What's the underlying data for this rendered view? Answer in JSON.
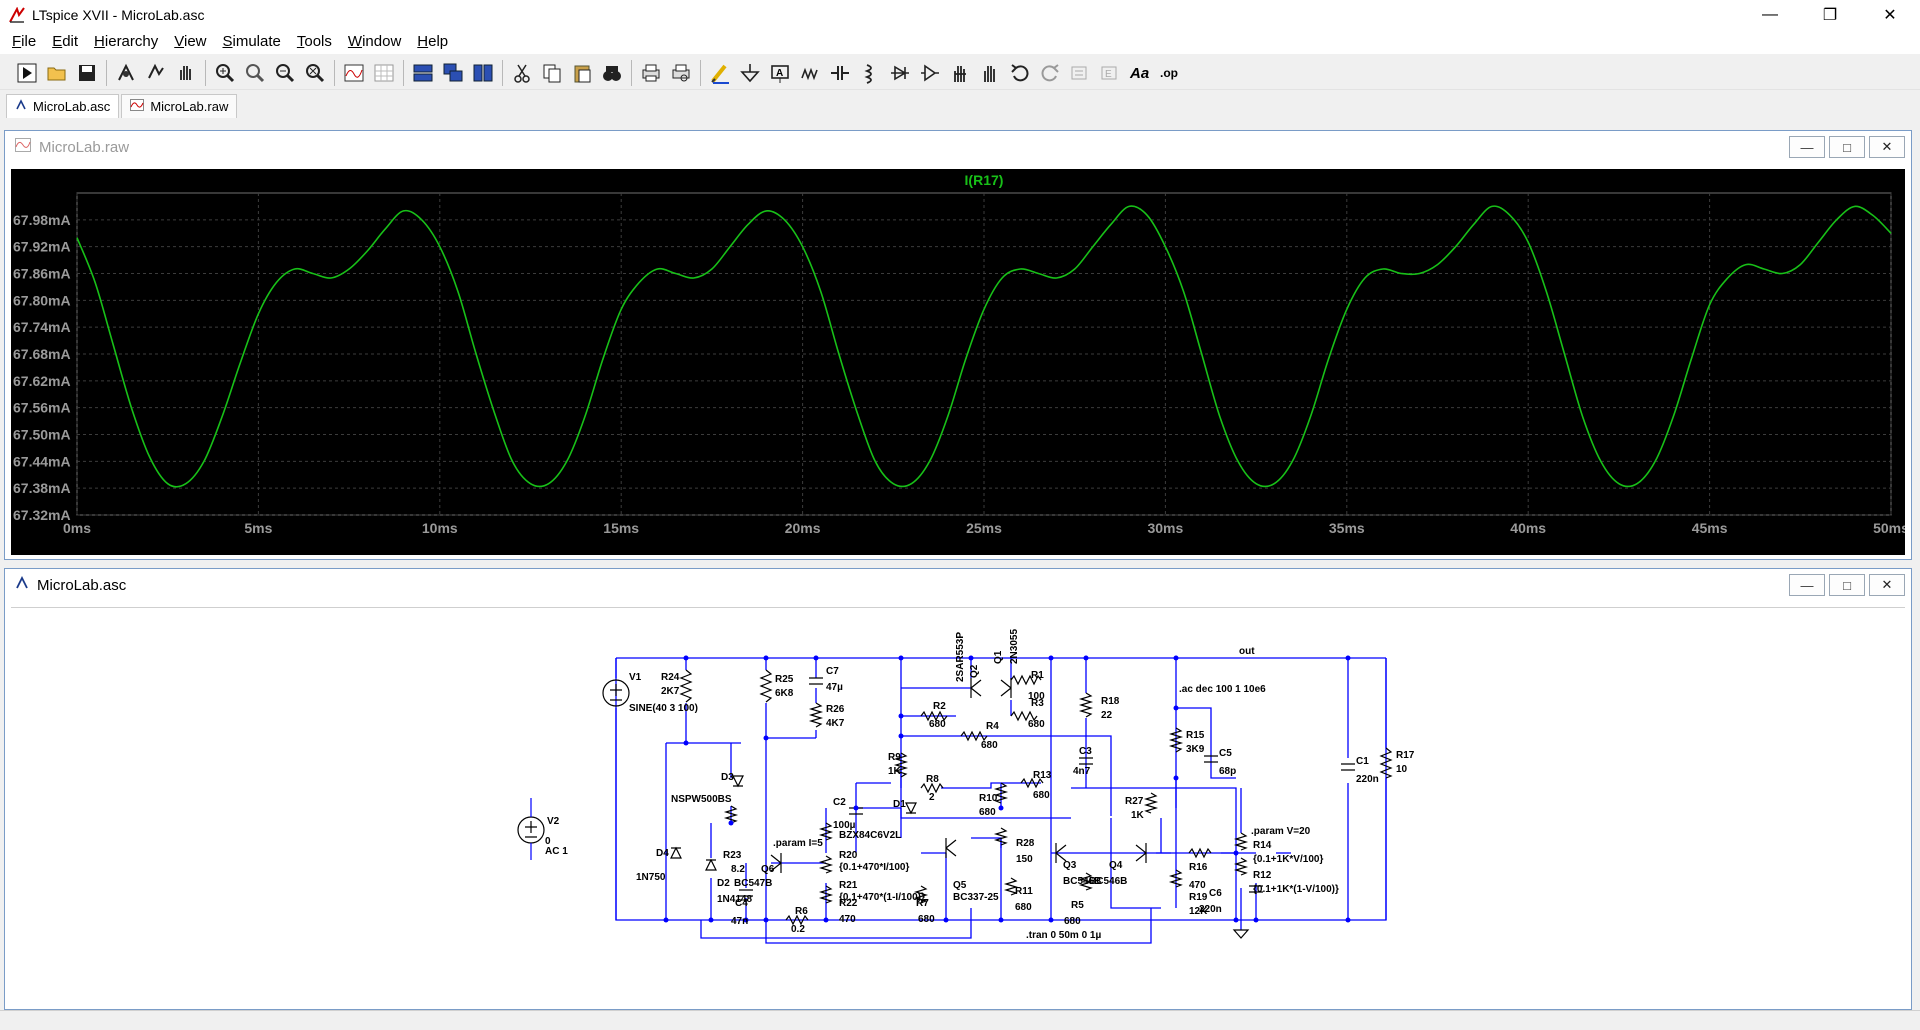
{
  "window": {
    "title": "LTspice XVII - MicroLab.asc",
    "controls": [
      "minimize-icon",
      "restore-icon",
      "close-icon"
    ]
  },
  "menu": [
    {
      "label": "File",
      "u": "F",
      "rest": "ile"
    },
    {
      "label": "Edit",
      "u": "E",
      "rest": "dit"
    },
    {
      "label": "Hierarchy",
      "u": "H",
      "rest": "ierarchy"
    },
    {
      "label": "View",
      "u": "V",
      "rest": "iew"
    },
    {
      "label": "Simulate",
      "u": "S",
      "rest": "imulate"
    },
    {
      "label": "Tools",
      "u": "T",
      "rest": "ools"
    },
    {
      "label": "Window",
      "u": "W",
      "rest": "indow"
    },
    {
      "label": "Help",
      "u": "H",
      "rest": "elp"
    }
  ],
  "toolbar": [
    "run-icon",
    "open-icon",
    "save-icon",
    "|",
    "control-panel-icon",
    "halt-icon",
    "pan-icon",
    "|",
    "zoom-in-icon",
    "zoom-full-icon",
    "zoom-out-icon",
    "zoom-cancel-icon",
    "|",
    "autorange-icon",
    "grid-icon",
    "|",
    "tile-horizontal-icon",
    "cascade-icon",
    "tile-vertical-icon",
    "|",
    "cut-icon",
    "copy-icon",
    "paste-icon",
    "find-icon",
    "|",
    "print-icon",
    "print-preview-icon",
    "|",
    "wire-icon",
    "ground-icon",
    "label-net-icon",
    "resistor-icon",
    "capacitor-icon",
    "inductor-icon",
    "diode-icon",
    "component-icon",
    "move-icon",
    "drag-icon",
    "undo-icon",
    "redo-icon",
    "rotate-icon",
    "mirror-icon",
    "text-icon",
    "spice-directive-icon"
  ],
  "tabs": [
    {
      "label": "MicroLab.asc",
      "icon": "schematic-icon",
      "active": true
    },
    {
      "label": "MicroLab.raw",
      "icon": "waveform-icon",
      "active": false
    }
  ],
  "wave_window": {
    "title": "MicroLab.raw",
    "trace_label": "I(R17)",
    "trace_color": "#18c018",
    "grid_color": "#3c3c3c",
    "label_color": "#9a9a9a"
  },
  "chart_data": {
    "type": "line",
    "title": "I(R17)",
    "xlabel": "",
    "ylabel": "",
    "xlim": [
      0,
      50
    ],
    "ylim": [
      67.32,
      68.04
    ],
    "x_ticks": [
      "0ms",
      "5ms",
      "10ms",
      "15ms",
      "20ms",
      "25ms",
      "30ms",
      "35ms",
      "40ms",
      "45ms",
      "50ms"
    ],
    "y_ticks": [
      "67.98mA",
      "67.92mA",
      "67.86mA",
      "67.80mA",
      "67.74mA",
      "67.68mA",
      "67.62mA",
      "67.56mA",
      "67.50mA",
      "67.44mA",
      "67.38mA",
      "67.32mA"
    ],
    "y_tick_values": [
      67.98,
      67.92,
      67.86,
      67.8,
      67.74,
      67.68,
      67.62,
      67.56,
      67.5,
      67.44,
      67.38,
      67.32
    ],
    "grid": true,
    "series": [
      {
        "name": "I(R17)",
        "x": [
          0,
          0.5,
          1,
          1.5,
          2,
          2.5,
          3,
          3.5,
          4,
          4.5,
          5,
          5.5,
          6,
          6.5,
          7,
          7.5,
          8,
          8.5,
          9,
          9.5,
          10,
          10.5,
          11,
          11.5,
          12,
          12.5,
          13,
          13.5,
          14,
          14.5,
          15,
          15.5,
          16,
          16.5,
          17,
          17.5,
          18,
          18.5,
          19,
          19.5,
          20,
          20.5,
          21,
          21.5,
          22,
          22.5,
          23,
          23.5,
          24,
          24.5,
          25,
          25.5,
          26,
          26.5,
          27,
          27.5,
          28,
          28.5,
          29,
          29.5,
          30,
          30.5,
          31,
          31.5,
          32,
          32.5,
          33,
          33.5,
          34,
          34.5,
          35,
          35.5,
          36,
          36.5,
          37,
          37.5,
          38,
          38.5,
          39,
          39.5,
          40,
          40.5,
          41,
          41.5,
          42,
          42.5,
          43,
          43.5,
          44,
          44.5,
          45,
          45.5,
          46,
          46.5,
          47,
          47.5,
          48,
          48.5,
          49,
          49.5,
          50
        ],
        "values": [
          67.94,
          67.84,
          67.7,
          67.56,
          67.45,
          67.39,
          67.39,
          67.44,
          67.54,
          67.66,
          67.77,
          67.84,
          67.87,
          67.86,
          67.85,
          67.87,
          67.91,
          67.96,
          68.0,
          67.98,
          67.92,
          67.82,
          67.68,
          67.55,
          67.44,
          67.39,
          67.39,
          67.44,
          67.54,
          67.67,
          67.78,
          67.84,
          67.87,
          67.86,
          67.85,
          67.87,
          67.92,
          67.97,
          68.0,
          67.98,
          67.92,
          67.82,
          67.68,
          67.55,
          67.44,
          67.39,
          67.39,
          67.44,
          67.54,
          67.67,
          67.78,
          67.85,
          67.87,
          67.86,
          67.85,
          67.87,
          67.92,
          67.97,
          68.01,
          67.99,
          67.92,
          67.82,
          67.68,
          67.54,
          67.44,
          67.39,
          67.39,
          67.44,
          67.54,
          67.67,
          67.78,
          67.85,
          67.87,
          67.86,
          67.86,
          67.88,
          67.92,
          67.97,
          68.01,
          67.99,
          67.93,
          67.82,
          67.68,
          67.54,
          67.44,
          67.39,
          67.39,
          67.44,
          67.54,
          67.67,
          67.79,
          67.85,
          67.88,
          67.87,
          67.86,
          67.88,
          67.93,
          67.98,
          68.01,
          67.99,
          67.95
        ]
      }
    ]
  },
  "schem_window": {
    "title": "MicroLab.asc",
    "wire_color": "#0000ff",
    "component_color": "#000000",
    "labels": {
      "out": "out",
      "v1": "V1",
      "v1_val": "SINE(40 3 100)",
      "v2": "V2",
      "v2_v": "0",
      "v2_ac": "AC 1",
      "r24": "R24",
      "r24_v": "2K7",
      "r25": "R25",
      "r25_v": "6K8",
      "c7": "C7",
      "c7_v": "47µ",
      "r26": "R26",
      "r26_v": "4K7",
      "q2": "Q2",
      "q2_t": "2SAR553P",
      "q1": "Q1",
      "q1_t": "2N3055",
      "r1": "R1",
      "r1_v": "100",
      "r2": "R2",
      "r2_v": "680",
      "r3": "R3",
      "r3_v": "680",
      "r4": "R4",
      "r4_v": "680",
      "r18": "R18",
      "r18_v": "22",
      "ac_dir": ".ac dec 100 1 10e6",
      "r15": "R15",
      "r15_v": "3K9",
      "c5": "C5",
      "c5_v": "68p",
      "c1": "C1",
      "c1_v": "220n",
      "r17": "R17",
      "r17_v": "10",
      "r9": "R9",
      "r9_v": "1K",
      "c3": "C3",
      "c3_v": "4n7",
      "d3": "D3",
      "d3_t": "NSPW500BS",
      "r8": "R8",
      "r8_v": "2",
      "r13": "R13",
      "r13_v": "680",
      "c2": "C2",
      "c2_v": "100µ",
      "d1": "D1",
      "d1_t": "BZX84C6V2L",
      "r10": "R10",
      "r10_v": "680",
      "r27": "R27",
      "r27_v": "1K",
      "param_v": ".param V=20",
      "param_i": ".param I=5",
      "r14": "R14",
      "r14_v": "{0.1+1K*V/100}",
      "r12": "R12",
      "r12_v": "{0.1+1K*(1-V/100)}",
      "d4": "D4",
      "d4_t": "1N750",
      "r23": "R23",
      "r23_v": "8.2",
      "q6": "Q6",
      "q6_t": "BC547B",
      "r20": "R20",
      "r20_v": "{0.1+470*I/100}",
      "r28": "R28",
      "r28_v": "150",
      "q3": "Q3",
      "q3_t": "BC546B",
      "q4": "Q4",
      "q4_t": "BC546B",
      "r16": "R16",
      "r16_v": "470",
      "d2": "D2",
      "d2_t": "1N4148",
      "r21": "R21",
      "r21_v": "{0.1+470*(1-I/100)}",
      "q5": "Q5",
      "q5_t": "BC337-25",
      "r19": "R19",
      "r19_v": "12K",
      "c6": "C6",
      "c6_v": "220n",
      "c4": "C4",
      "c4_v": "47n",
      "r22": "R22",
      "r22_v": "470",
      "r7": "R7",
      "r7_v": "680",
      "r11": "R11",
      "r11_v": "680",
      "r5": "R5",
      "r5_v": "680",
      "r6": "R6",
      "r6_v": "0.2",
      "tran_dir": ".tran 0 50m 0 1µ"
    }
  }
}
